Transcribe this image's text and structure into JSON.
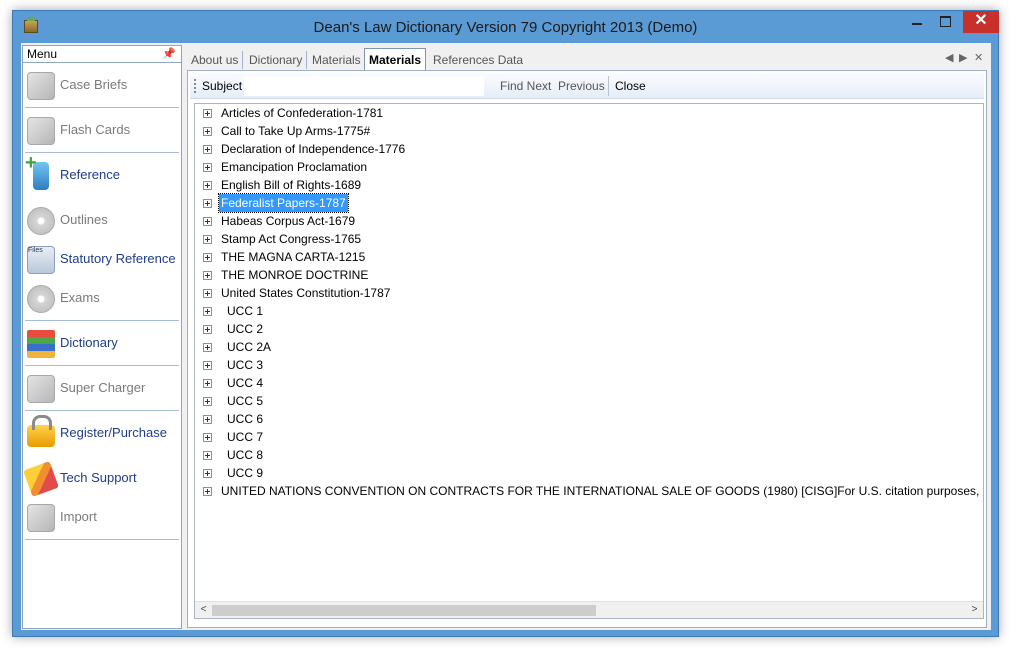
{
  "window": {
    "title": "Dean's Law Dictionary  Version 79 Copyright 2013 (Demo)",
    "min_glyph": "",
    "max_glyph": "",
    "close_glyph": "✕"
  },
  "sidebar": {
    "header": "Menu",
    "pin_glyph": "📌",
    "items": [
      {
        "label": "Case Briefs",
        "icon": "case-briefs-icon",
        "enabled": false
      },
      {
        "label": "Flash Cards",
        "icon": "flash-cards-icon",
        "enabled": false
      },
      {
        "label": "Reference",
        "icon": "reference-icon",
        "enabled": true
      },
      {
        "label": "Outlines",
        "icon": "outlines-disc-icon",
        "enabled": false
      },
      {
        "label": "Statutory Reference",
        "icon": "files-icon",
        "enabled": true
      },
      {
        "label": "Exams",
        "icon": "exams-icon",
        "enabled": false
      },
      {
        "label": "Dictionary",
        "icon": "books-icon",
        "enabled": true
      },
      {
        "label": "Super Charger",
        "icon": "super-charger-icon",
        "enabled": false
      },
      {
        "label": "Register/Purchase",
        "icon": "lock-icon",
        "enabled": true
      },
      {
        "label": "Tech Support",
        "icon": "pencil-icon",
        "enabled": true
      },
      {
        "label": "Import",
        "icon": "import-icon",
        "enabled": false
      }
    ],
    "files_icon_text": "Files"
  },
  "tabs": [
    {
      "label": "About us",
      "active": false
    },
    {
      "label": "Dictionary",
      "active": false
    },
    {
      "label": "Materials",
      "active": false
    },
    {
      "label": "Materials",
      "active": true
    },
    {
      "label": "References Data",
      "active": false
    }
  ],
  "tab_nav": {
    "prev": "◀",
    "next": "▶",
    "close": "✕"
  },
  "toolbar": {
    "subject_label": "Subject",
    "subject_value": "",
    "find_next": "Find Next",
    "previous": "Previous",
    "close": "Close"
  },
  "tree": {
    "nodes": [
      {
        "label": "Articles of Confederation-1781",
        "selected": false,
        "ucc": false
      },
      {
        "label": "Call to Take Up Arms-1775#",
        "selected": false,
        "ucc": false
      },
      {
        "label": "Declaration of Independence-1776",
        "selected": false,
        "ucc": false
      },
      {
        "label": "Emancipation Proclamation",
        "selected": false,
        "ucc": false
      },
      {
        "label": "English Bill of Rights-1689",
        "selected": false,
        "ucc": false
      },
      {
        "label": "Federalist Papers-1787",
        "selected": true,
        "ucc": false
      },
      {
        "label": "Habeas Corpus Act-1679",
        "selected": false,
        "ucc": false
      },
      {
        "label": "Stamp Act Congress-1765",
        "selected": false,
        "ucc": false
      },
      {
        "label": "THE MAGNA CARTA-1215",
        "selected": false,
        "ucc": false
      },
      {
        "label": "THE MONROE DOCTRINE",
        "selected": false,
        "ucc": false
      },
      {
        "label": "United States Constitution-1787",
        "selected": false,
        "ucc": false
      },
      {
        "label": "UCC 1",
        "selected": false,
        "ucc": true
      },
      {
        "label": "UCC 2",
        "selected": false,
        "ucc": true
      },
      {
        "label": "UCC 2A",
        "selected": false,
        "ucc": true
      },
      {
        "label": "UCC 3",
        "selected": false,
        "ucc": true
      },
      {
        "label": "UCC 4",
        "selected": false,
        "ucc": true
      },
      {
        "label": "UCC 5",
        "selected": false,
        "ucc": true
      },
      {
        "label": "UCC 6",
        "selected": false,
        "ucc": true
      },
      {
        "label": "UCC 7",
        "selected": false,
        "ucc": true
      },
      {
        "label": "UCC 8",
        "selected": false,
        "ucc": true
      },
      {
        "label": "UCC 9",
        "selected": false,
        "ucc": true
      },
      {
        "label": "UNITED NATIONS CONVENTION ON CONTRACTS FOR THE INTERNATIONAL SALE OF GOODS (1980) [CISG]For U.S. citation purposes, th",
        "selected": false,
        "ucc": false
      }
    ]
  },
  "scrollbar": {
    "left_glyph": "<",
    "right_glyph": ">"
  },
  "colors": {
    "accent": "#5b9bd5",
    "selection": "#3399ff",
    "close_red": "#c7302b",
    "menu_text": "#1f3c88"
  }
}
